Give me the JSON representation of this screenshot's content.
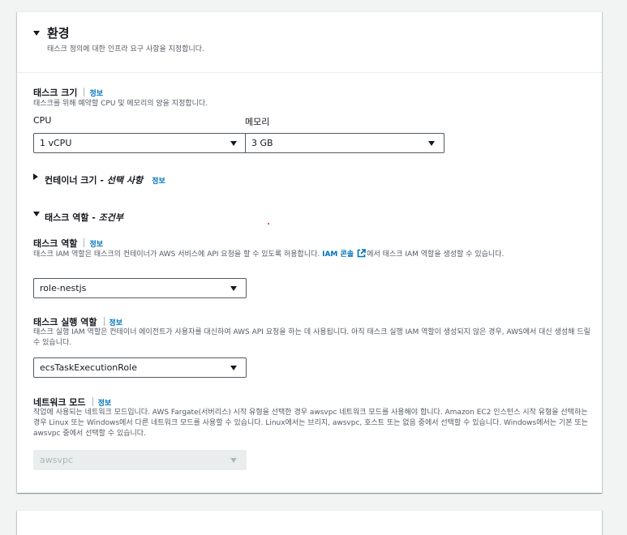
{
  "section": {
    "title": "환경",
    "description": "태스크 정의에 대한 인프라 요구 사항을 지정합니다."
  },
  "info_label": "정보",
  "task_size": {
    "label": "태스크 크기",
    "description": "태스크를 위해 예약할 CPU 및 메모리의 양을 지정합니다.",
    "cpu_label": "CPU",
    "cpu_value": "1 vCPU",
    "memory_label": "메모리",
    "memory_value": "3 GB"
  },
  "container_size": {
    "label": "컨테이너 크기 - ",
    "label_italic": "선택 사항"
  },
  "task_role_section": {
    "label": "태스크 역할 - ",
    "label_italic": "조건부"
  },
  "task_role": {
    "label": "태스크 역할",
    "description_before": "태스크 IAM 역할은 태스크의 컨테이너가 AWS 서비스에 API 요청을 할 수 있도록 허용합니다. ",
    "link_text": "IAM 콘솔",
    "description_after": "에서 태스크 IAM 역할을 생성할 수 있습니다.",
    "value": "role-nestjs"
  },
  "execution_role": {
    "label": "태스크 실행 역할",
    "description": "태스크 실행 IAM 역할은 컨테이너 에이전트가 사용자를 대신하여 AWS API 요청을 하는 데 사용됩니다. 아직 태스크 실행 IAM 역할이 생성되지 않은 경우, AWS에서 대신 생성해 드릴 수 있습니다.",
    "value": "ecsTaskExecutionRole"
  },
  "network_mode": {
    "label": "네트워크 모드",
    "description": "작업에 사용되는 네트워크 모드입니다. AWS Fargate(서버리스) 시작 유형을 선택한 경우 awsvpc 네트워크 모드를 사용해야 합니다. Amazon EC2 인스턴스 시작 유형을 선택하는 경우 Linux 또는 Windows에서 다른 네트워크 모드를 사용할 수 있습니다. Linux에서는 브리지, awsvpc, 호스트 또는 없음 중에서 선택할 수 있습니다. Windows에서는 기본 또는 awsvpc 중에서 선택할 수 있습니다.",
    "value": "awsvpc"
  },
  "colors": {
    "link": "#0073bb",
    "text": "#16191f",
    "muted": "#545b64",
    "background": "#f2f3f3"
  }
}
